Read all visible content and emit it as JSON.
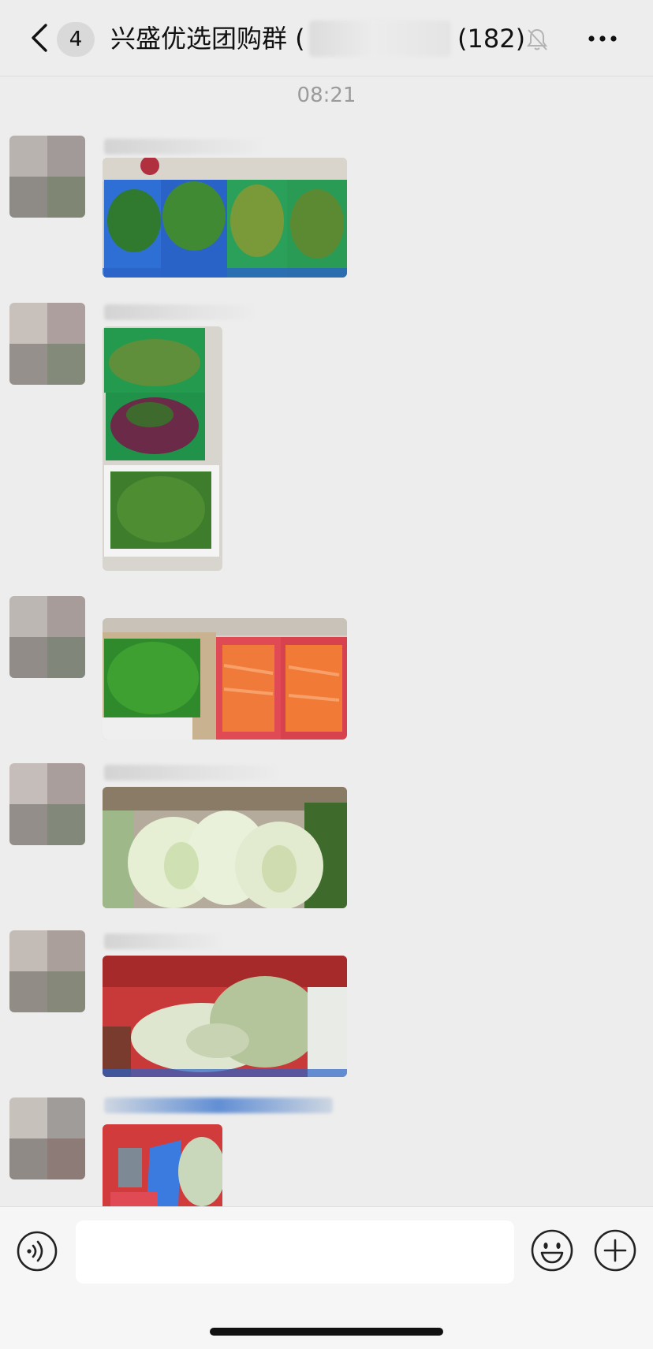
{
  "header": {
    "unread_count": "4",
    "title": "兴盛优选团购群 (",
    "member_count": "(182)",
    "icons": {
      "back": "chevron-left-icon",
      "mute": "bell-slash-icon",
      "more": "more-dots-icon"
    }
  },
  "chat": {
    "timestamp": "08:21",
    "messages": [
      {
        "type": "image",
        "content": "photo: leafy greens and long beans in crates"
      },
      {
        "type": "image",
        "content": "photo: long beans, red amaranth and okra"
      },
      {
        "type": "image",
        "content": "photo: green peppers and carrots"
      },
      {
        "type": "image",
        "content": "photo: napa cabbage in plastic bags"
      },
      {
        "type": "image",
        "content": "photo: bagged radishes"
      },
      {
        "type": "image",
        "content": "photo: bagged vegetables by red stand"
      }
    ]
  },
  "input_bar": {
    "text_value": "",
    "icons": {
      "voice": "voice-icon",
      "emoji": "emoji-icon",
      "add": "plus-circle-icon"
    }
  },
  "colors": {
    "background": "#ededed",
    "input_bar": "#f6f6f6"
  }
}
